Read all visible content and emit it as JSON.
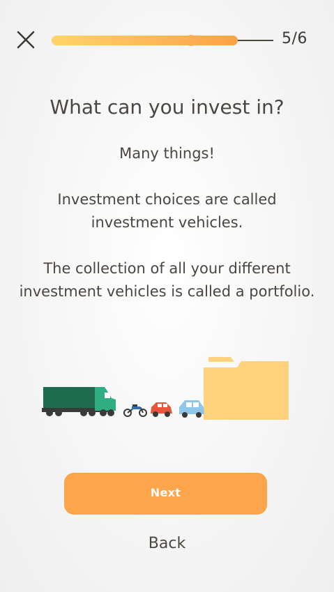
{
  "header": {
    "close_icon": "close-icon",
    "progress": {
      "value": 0.63,
      "step": 5,
      "total": 6
    },
    "step_counter": "5/6"
  },
  "content": {
    "title": "What can you invest in?",
    "paragraph_1": "Many things!",
    "paragraph_2": "Investment choices are called\ninvestment vehicles.",
    "paragraph_3": "The collection of all your different\ninvestment vehicles is called a portfolio."
  },
  "illustration": {
    "icons": [
      "truck-icon",
      "motorcycle-icon",
      "red-car-icon",
      "blue-car-icon",
      "folder-icon"
    ],
    "colors": {
      "truck_trailer": "#1f6b4f",
      "truck_cab": "#2fae82",
      "red_car": "#e8553a",
      "blue_car": "#8fc6ea",
      "folder": "#ffd37e"
    }
  },
  "actions": {
    "next_label": "Next",
    "back_label": "Back"
  },
  "theme": {
    "accent": "#fca54a",
    "text": "#4a4640",
    "progress_start": "#ffd469",
    "progress_end": "#fba245"
  }
}
